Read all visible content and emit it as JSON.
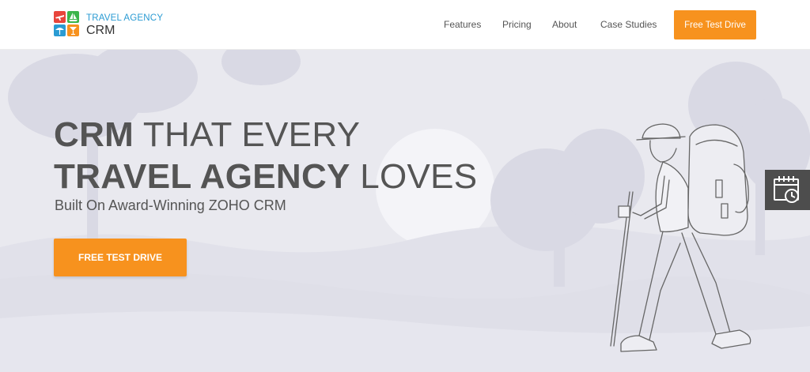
{
  "brand": {
    "line1": "TRAVEL AGENCY",
    "line2": "CRM",
    "logo_tiles": [
      {
        "color": "#e8453c",
        "icon": "plane-icon"
      },
      {
        "color": "#3bb54a",
        "icon": "sailboat-icon"
      },
      {
        "color": "#2a9bd3",
        "icon": "umbrella-icon"
      },
      {
        "color": "#f7921e",
        "icon": "cocktail-icon"
      }
    ]
  },
  "nav": {
    "items": [
      {
        "label": "Features"
      },
      {
        "label": "Pricing"
      },
      {
        "label": "About"
      },
      {
        "label": "Case Studies"
      }
    ],
    "cta_label": "Free Test Drive"
  },
  "hero": {
    "headline_line1_bold": "CRM",
    "headline_line1_rest": " THAT EVERY",
    "headline_line2_bold": "TRAVEL AGENCY",
    "headline_line2_rest": " LOVES",
    "subline": "Built On Award-Winning ZOHO CRM",
    "cta_label": "FREE TEST DRIVE",
    "illustration": "hiker-with-backpack-illustration"
  },
  "side_widget": {
    "icon": "calendar-clock-icon"
  },
  "colors": {
    "accent": "#f7921e",
    "hero_bg": "#e9e9ef",
    "brand_blue": "#2a9bd3",
    "widget_bg": "#4d4d4d"
  }
}
